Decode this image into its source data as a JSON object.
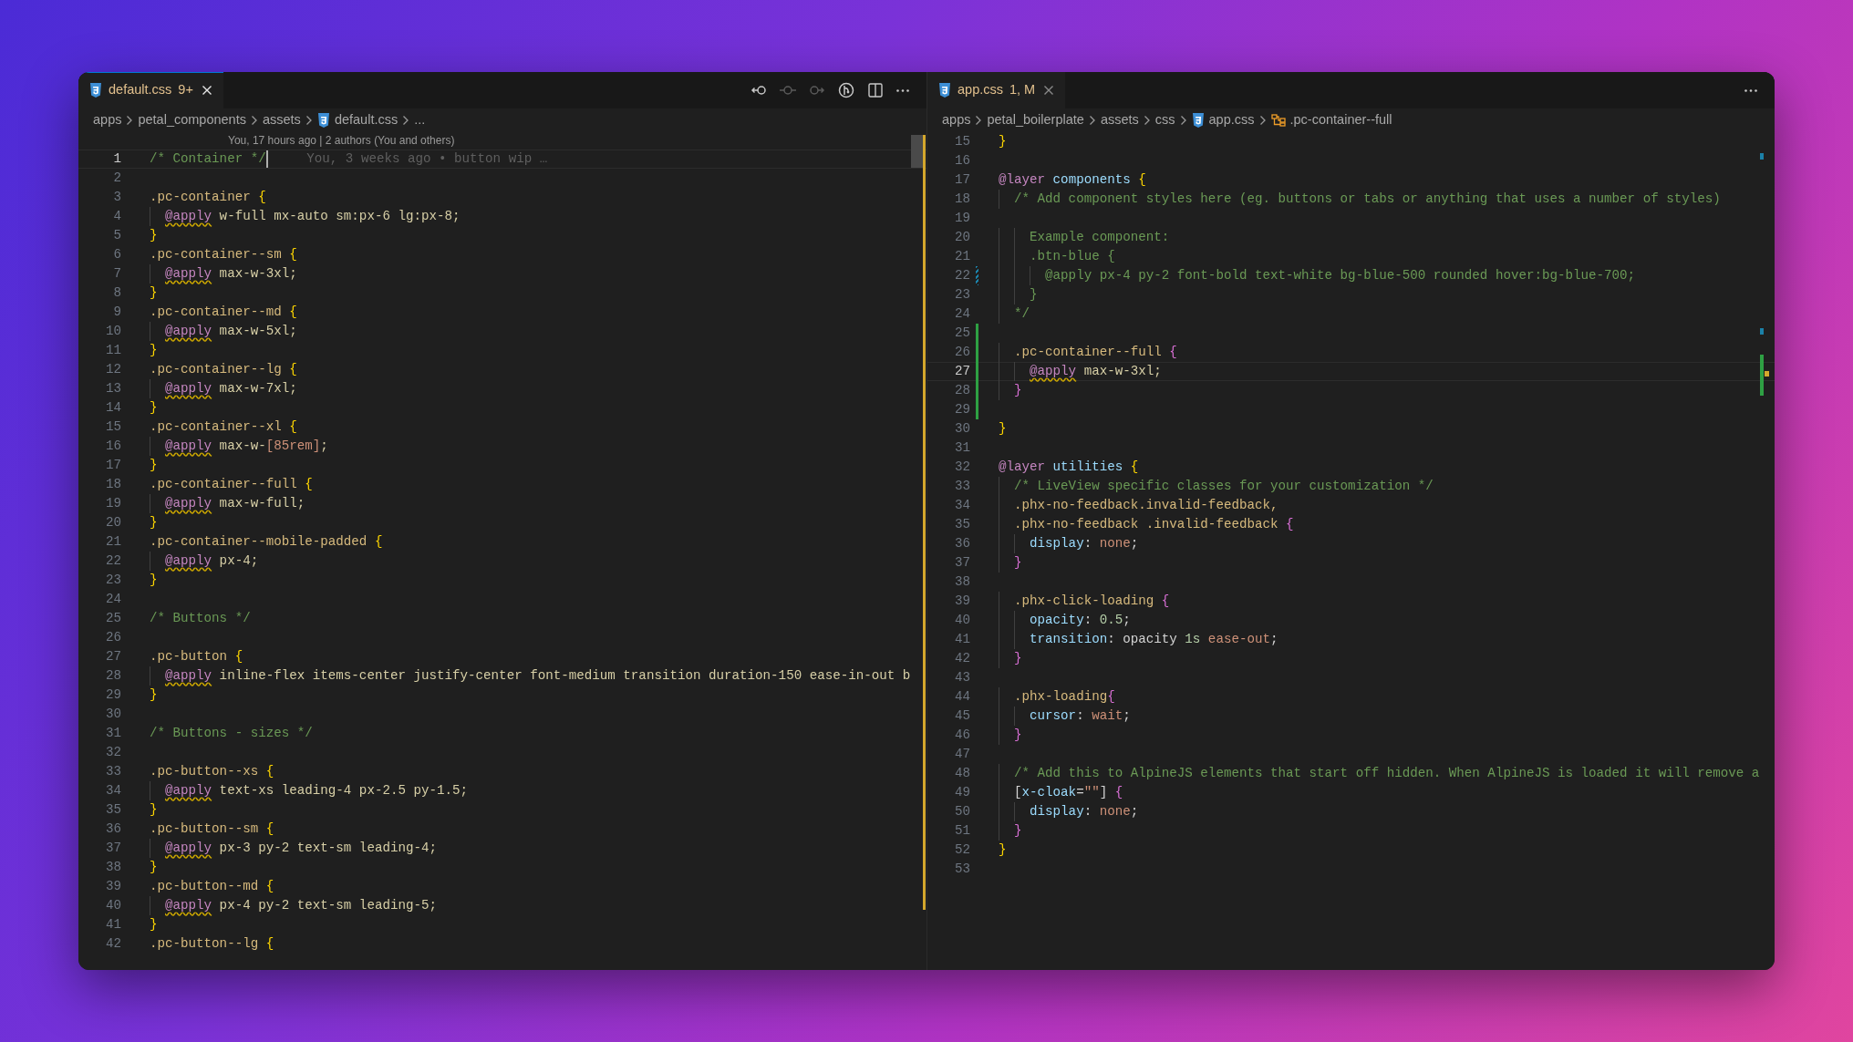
{
  "panes": [
    {
      "focused": true,
      "tab": {
        "name": "default.css",
        "badge": "9+"
      },
      "toolbar": [
        {
          "kind": "back",
          "disabled": false
        },
        {
          "kind": "commit",
          "disabled": true
        },
        {
          "kind": "forward",
          "disabled": true
        },
        {
          "kind": "git",
          "disabled": false
        },
        {
          "kind": "split",
          "disabled": false
        },
        {
          "kind": "more",
          "disabled": false
        }
      ],
      "breadcrumb": [
        {
          "label": "apps"
        },
        {
          "label": "petal_components"
        },
        {
          "label": "assets"
        },
        {
          "label": "default.css",
          "kind": "css"
        },
        {
          "label": "..."
        }
      ],
      "codelens": "You, 17 hours ago | 2 authors (You and others)",
      "lines": [
        {
          "n": "1",
          "active": true,
          "blame": "You, 3 weeks ago • button wip …",
          "tokens": [
            {
              "t": "/* Container */",
              "kind": "comment"
            }
          ]
        },
        {
          "n": "2",
          "active": false
        },
        {
          "n": "3",
          "active": false,
          "tokens": [
            {
              "t": ".pc-container ",
              "kind": "selector"
            },
            {
              "t": "{",
              "kind": "brace1"
            }
          ]
        },
        {
          "n": "4",
          "active": false,
          "tokens": [
            {
              "t": "  @apply",
              "kind": "apply"
            },
            {
              "t": " w-full mx-auto sm:px-6 lg:px-8;",
              "kind": "plain"
            }
          ]
        },
        {
          "n": "5",
          "active": false,
          "tokens": [
            {
              "t": "}",
              "kind": "brace1"
            }
          ]
        },
        {
          "n": "6",
          "active": false,
          "tokens": [
            {
              "t": ".pc-container--sm ",
              "kind": "selector"
            },
            {
              "t": "{",
              "kind": "brace1"
            }
          ]
        },
        {
          "n": "7",
          "active": false,
          "tokens": [
            {
              "t": "  @apply",
              "kind": "apply"
            },
            {
              "t": " max-w-3xl;",
              "kind": "plain"
            }
          ]
        },
        {
          "n": "8",
          "active": false,
          "tokens": [
            {
              "t": "}",
              "kind": "brace1"
            }
          ]
        },
        {
          "n": "9",
          "active": false,
          "tokens": [
            {
              "t": ".pc-container--md ",
              "kind": "selector"
            },
            {
              "t": "{",
              "kind": "brace1"
            }
          ]
        },
        {
          "n": "10",
          "active": false,
          "tokens": [
            {
              "t": "  @apply",
              "kind": "apply"
            },
            {
              "t": " max-w-5xl;",
              "kind": "plain"
            }
          ]
        },
        {
          "n": "11",
          "active": false,
          "tokens": [
            {
              "t": "}",
              "kind": "brace1"
            }
          ]
        },
        {
          "n": "12",
          "active": false,
          "tokens": [
            {
              "t": ".pc-container--lg ",
              "kind": "selector"
            },
            {
              "t": "{",
              "kind": "brace1"
            }
          ]
        },
        {
          "n": "13",
          "active": false,
          "tokens": [
            {
              "t": "  @apply",
              "kind": "apply"
            },
            {
              "t": " max-w-7xl;",
              "kind": "plain"
            }
          ]
        },
        {
          "n": "14",
          "active": false,
          "tokens": [
            {
              "t": "}",
              "kind": "brace1"
            }
          ]
        },
        {
          "n": "15",
          "active": false,
          "tokens": [
            {
              "t": ".pc-container--xl ",
              "kind": "selector"
            },
            {
              "t": "{",
              "kind": "brace1"
            }
          ]
        },
        {
          "n": "16",
          "active": false,
          "tokens": [
            {
              "t": "  @apply",
              "kind": "apply"
            },
            {
              "t": " max-w-",
              "kind": "plain"
            },
            {
              "t": "[85rem]",
              "kind": "value"
            },
            {
              "t": ";",
              "kind": "plain"
            }
          ]
        },
        {
          "n": "17",
          "active": false,
          "tokens": [
            {
              "t": "}",
              "kind": "brace1"
            }
          ]
        },
        {
          "n": "18",
          "active": false,
          "tokens": [
            {
              "t": ".pc-container--full ",
              "kind": "selector"
            },
            {
              "t": "{",
              "kind": "brace1"
            }
          ]
        },
        {
          "n": "19",
          "active": false,
          "tokens": [
            {
              "t": "  @apply",
              "kind": "apply"
            },
            {
              "t": " max-w-full;",
              "kind": "plain"
            }
          ]
        },
        {
          "n": "20",
          "active": false,
          "tokens": [
            {
              "t": "}",
              "kind": "brace1"
            }
          ]
        },
        {
          "n": "21",
          "active": false,
          "tokens": [
            {
              "t": ".pc-container--mobile-padded ",
              "kind": "selector"
            },
            {
              "t": "{",
              "kind": "brace1"
            }
          ]
        },
        {
          "n": "22",
          "active": false,
          "tokens": [
            {
              "t": "  @apply",
              "kind": "apply"
            },
            {
              "t": " px-4;",
              "kind": "plain"
            }
          ]
        },
        {
          "n": "23",
          "active": false,
          "tokens": [
            {
              "t": "}",
              "kind": "brace1"
            }
          ]
        },
        {
          "n": "24",
          "active": false
        },
        {
          "n": "25",
          "active": false,
          "tokens": [
            {
              "t": "/* Buttons */",
              "kind": "comment"
            }
          ]
        },
        {
          "n": "26",
          "active": false
        },
        {
          "n": "27",
          "active": false,
          "tokens": [
            {
              "t": ".pc-button ",
              "kind": "selector"
            },
            {
              "t": "{",
              "kind": "brace1"
            }
          ]
        },
        {
          "n": "28",
          "active": false,
          "tokens": [
            {
              "t": "  @apply",
              "kind": "apply"
            },
            {
              "t": " inline-flex items-center justify-center font-medium transition duration-150 ease-in-out b",
              "kind": "plain"
            }
          ]
        },
        {
          "n": "29",
          "active": false,
          "tokens": [
            {
              "t": "}",
              "kind": "brace1"
            }
          ]
        },
        {
          "n": "30",
          "active": false
        },
        {
          "n": "31",
          "active": false,
          "tokens": [
            {
              "t": "/* Buttons - sizes */",
              "kind": "comment"
            }
          ]
        },
        {
          "n": "32",
          "active": false
        },
        {
          "n": "33",
          "active": false,
          "tokens": [
            {
              "t": ".pc-button--xs ",
              "kind": "selector"
            },
            {
              "t": "{",
              "kind": "brace1"
            }
          ]
        },
        {
          "n": "34",
          "active": false,
          "tokens": [
            {
              "t": "  @apply",
              "kind": "apply"
            },
            {
              "t": " text-xs leading-4 px-2.5 py-1.5;",
              "kind": "plain"
            }
          ]
        },
        {
          "n": "35",
          "active": false,
          "tokens": [
            {
              "t": "}",
              "kind": "brace1"
            }
          ]
        },
        {
          "n": "36",
          "active": false,
          "tokens": [
            {
              "t": ".pc-button--sm ",
              "kind": "selector"
            },
            {
              "t": "{",
              "kind": "brace1"
            }
          ]
        },
        {
          "n": "37",
          "active": false,
          "tokens": [
            {
              "t": "  @apply",
              "kind": "apply"
            },
            {
              "t": " px-3 py-2 text-sm leading-4;",
              "kind": "plain"
            }
          ]
        },
        {
          "n": "38",
          "active": false,
          "tokens": [
            {
              "t": "}",
              "kind": "brace1"
            }
          ]
        },
        {
          "n": "39",
          "active": false,
          "tokens": [
            {
              "t": ".pc-button--md ",
              "kind": "selector"
            },
            {
              "t": "{",
              "kind": "brace1"
            }
          ]
        },
        {
          "n": "40",
          "active": false,
          "tokens": [
            {
              "t": "  @apply",
              "kind": "apply"
            },
            {
              "t": " px-4 py-2 text-sm leading-5;",
              "kind": "plain"
            }
          ]
        },
        {
          "n": "41",
          "active": false,
          "tokens": [
            {
              "t": "}",
              "kind": "brace1"
            }
          ]
        },
        {
          "n": "42",
          "active": false,
          "tokens": [
            {
              "t": ".pc-button--lg ",
              "kind": "selector"
            },
            {
              "t": "{",
              "kind": "brace1"
            }
          ]
        }
      ]
    },
    {
      "focused": false,
      "tab": {
        "name": "app.css",
        "badge": "1, M"
      },
      "toolbar": [
        {
          "kind": "more",
          "disabled": false
        }
      ],
      "breadcrumb": [
        {
          "label": "apps"
        },
        {
          "label": "petal_boilerplate"
        },
        {
          "label": "assets"
        },
        {
          "label": "css"
        },
        {
          "label": "app.css",
          "kind": "css"
        },
        {
          "label": ".pc-container--full",
          "kind": "symbol"
        }
      ],
      "lines": [
        {
          "n": "15",
          "active": false,
          "tokens": [
            {
              "t": "}",
              "kind": "brace1"
            }
          ]
        },
        {
          "n": "16",
          "active": false
        },
        {
          "n": "17",
          "active": false,
          "tokens": [
            {
              "t": "@layer",
              "kind": "keyword"
            },
            {
              "t": " components ",
              "kind": "name"
            },
            {
              "t": "{",
              "kind": "brace1"
            }
          ]
        },
        {
          "n": "18",
          "active": false,
          "tokens": [
            {
              "t": "  /* Add component styles here (eg. buttons or tabs or anything that uses a number of styles)",
              "kind": "comment"
            }
          ]
        },
        {
          "n": "19",
          "active": false
        },
        {
          "n": "20",
          "active": false,
          "tokens": [
            {
              "t": "    Example component:",
              "kind": "comment"
            }
          ]
        },
        {
          "n": "21",
          "active": false,
          "tokens": [
            {
              "t": "    .btn-blue {",
              "kind": "comment"
            }
          ]
        },
        {
          "n": "22",
          "active": false,
          "kind": "modified",
          "tokens": [
            {
              "t": "      @apply px-4 py-2 font-bold text-white bg-blue-500 rounded hover:bg-blue-700;",
              "kind": "comment"
            }
          ]
        },
        {
          "n": "23",
          "active": false,
          "tokens": [
            {
              "t": "    }",
              "kind": "comment"
            }
          ]
        },
        {
          "n": "24",
          "active": false,
          "tokens": [
            {
              "t": "  */",
              "kind": "comment"
            }
          ]
        },
        {
          "n": "25",
          "active": false,
          "kind": "added"
        },
        {
          "n": "26",
          "active": false,
          "kind": "added",
          "tokens": [
            {
              "t": "  .pc-container--full ",
              "kind": "selector"
            },
            {
              "t": "{",
              "kind": "brace2"
            }
          ]
        },
        {
          "n": "27",
          "active": true,
          "kind": "added",
          "tokens": [
            {
              "t": "    @apply",
              "kind": "apply"
            },
            {
              "t": " max-w-3xl;",
              "kind": "plain"
            }
          ]
        },
        {
          "n": "28",
          "active": false,
          "kind": "added",
          "tokens": [
            {
              "t": "  }",
              "kind": "brace2"
            }
          ]
        },
        {
          "n": "29",
          "active": false,
          "kind": "added"
        },
        {
          "n": "30",
          "active": false,
          "tokens": [
            {
              "t": "}",
              "kind": "brace1"
            }
          ]
        },
        {
          "n": "31",
          "active": false
        },
        {
          "n": "32",
          "active": false,
          "tokens": [
            {
              "t": "@layer",
              "kind": "keyword"
            },
            {
              "t": " utilities ",
              "kind": "name"
            },
            {
              "t": "{",
              "kind": "brace1"
            }
          ]
        },
        {
          "n": "33",
          "active": false,
          "tokens": [
            {
              "t": "  /* LiveView specific classes for your customization */",
              "kind": "comment"
            }
          ]
        },
        {
          "n": "34",
          "active": false,
          "tokens": [
            {
              "t": "  .phx-no-feedback.invalid-feedback,",
              "kind": "selector"
            }
          ]
        },
        {
          "n": "35",
          "active": false,
          "tokens": [
            {
              "t": "  .phx-no-feedback .invalid-feedback ",
              "kind": "selector"
            },
            {
              "t": "{",
              "kind": "brace2"
            }
          ]
        },
        {
          "n": "36",
          "active": false,
          "tokens": [
            {
              "t": "    display",
              "kind": "property"
            },
            {
              "t": ": ",
              "kind": "punct"
            },
            {
              "t": "none",
              "kind": "value"
            },
            {
              "t": ";",
              "kind": "punct"
            }
          ]
        },
        {
          "n": "37",
          "active": false,
          "tokens": [
            {
              "t": "  }",
              "kind": "brace2"
            }
          ]
        },
        {
          "n": "38",
          "active": false
        },
        {
          "n": "39",
          "active": false,
          "tokens": [
            {
              "t": "  .phx-click-loading ",
              "kind": "selector"
            },
            {
              "t": "{",
              "kind": "brace2"
            }
          ]
        },
        {
          "n": "40",
          "active": false,
          "tokens": [
            {
              "t": "    opacity",
              "kind": "property"
            },
            {
              "t": ": ",
              "kind": "punct"
            },
            {
              "t": "0.5",
              "kind": "number"
            },
            {
              "t": ";",
              "kind": "punct"
            }
          ]
        },
        {
          "n": "41",
          "active": false,
          "tokens": [
            {
              "t": "    transition",
              "kind": "property"
            },
            {
              "t": ": opacity ",
              "kind": "punct"
            },
            {
              "t": "1s",
              "kind": "number"
            },
            {
              "t": " ease-out",
              "kind": "value"
            },
            {
              "t": ";",
              "kind": "punct"
            }
          ]
        },
        {
          "n": "42",
          "active": false,
          "tokens": [
            {
              "t": "  }",
              "kind": "brace2"
            }
          ]
        },
        {
          "n": "43",
          "active": false
        },
        {
          "n": "44",
          "active": false,
          "tokens": [
            {
              "t": "  .phx-loading",
              "kind": "selector"
            },
            {
              "t": "{",
              "kind": "brace2"
            }
          ]
        },
        {
          "n": "45",
          "active": false,
          "tokens": [
            {
              "t": "    cursor",
              "kind": "property"
            },
            {
              "t": ": ",
              "kind": "punct"
            },
            {
              "t": "wait",
              "kind": "value"
            },
            {
              "t": ";",
              "kind": "punct"
            }
          ]
        },
        {
          "n": "46",
          "active": false,
          "tokens": [
            {
              "t": "  }",
              "kind": "brace2"
            }
          ]
        },
        {
          "n": "47",
          "active": false
        },
        {
          "n": "48",
          "active": false,
          "tokens": [
            {
              "t": "  /* Add this to AlpineJS elements that start off hidden. When AlpineJS is loaded it will remove a",
              "kind": "comment"
            }
          ]
        },
        {
          "n": "49",
          "active": false,
          "tokens": [
            {
              "t": "  [",
              "kind": "punct"
            },
            {
              "t": "x-cloak",
              "kind": "property"
            },
            {
              "t": "=",
              "kind": "punct"
            },
            {
              "t": "\"\"",
              "kind": "value"
            },
            {
              "t": "] ",
              "kind": "punct"
            },
            {
              "t": "{",
              "kind": "brace2"
            }
          ]
        },
        {
          "n": "50",
          "active": false,
          "tokens": [
            {
              "t": "    display",
              "kind": "property"
            },
            {
              "t": ": ",
              "kind": "punct"
            },
            {
              "t": "none",
              "kind": "value"
            },
            {
              "t": ";",
              "kind": "punct"
            }
          ]
        },
        {
          "n": "51",
          "active": false,
          "tokens": [
            {
              "t": "  }",
              "kind": "brace2"
            }
          ]
        },
        {
          "n": "52",
          "active": false,
          "tokens": [
            {
              "t": "}",
              "kind": "brace1"
            }
          ]
        },
        {
          "n": "53",
          "active": false
        }
      ]
    }
  ]
}
